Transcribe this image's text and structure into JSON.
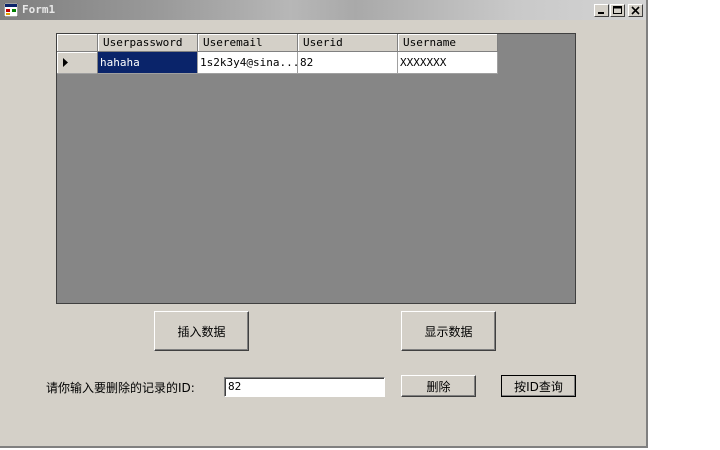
{
  "window": {
    "title": "Form1"
  },
  "grid": {
    "columns": [
      "Userpassword",
      "Useremail",
      "Userid",
      "Username"
    ],
    "rows": [
      [
        "hahaha",
        "1s2k3y4@sina...",
        "82",
        "XXXXXXX"
      ]
    ]
  },
  "buttons": {
    "insert_label": "插入数据",
    "show_label": "显示数据",
    "delete_label": "删除",
    "query_label": "按ID查询"
  },
  "delete_section": {
    "prompt": "请你输入要删除的记录的ID:",
    "id_value": "82"
  },
  "colors": {
    "form_bg": "#d4d0c8",
    "grid_bg": "#868686",
    "selection": "#0a246a"
  }
}
